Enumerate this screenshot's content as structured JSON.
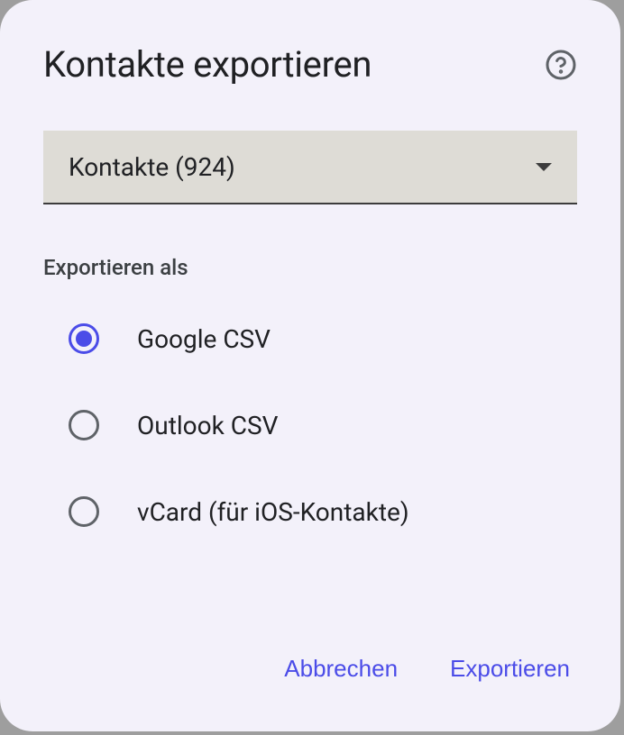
{
  "dialog": {
    "title": "Kontakte exportieren",
    "dropdown": {
      "selected": "Kontakte (924)"
    },
    "section_label": "Exportieren als",
    "radio_options": [
      {
        "label": "Google CSV",
        "selected": true
      },
      {
        "label": "Outlook CSV",
        "selected": false
      },
      {
        "label": "vCard (für iOS-Kontakte)",
        "selected": false
      }
    ],
    "actions": {
      "cancel": "Abbrechen",
      "confirm": "Exportieren"
    }
  }
}
